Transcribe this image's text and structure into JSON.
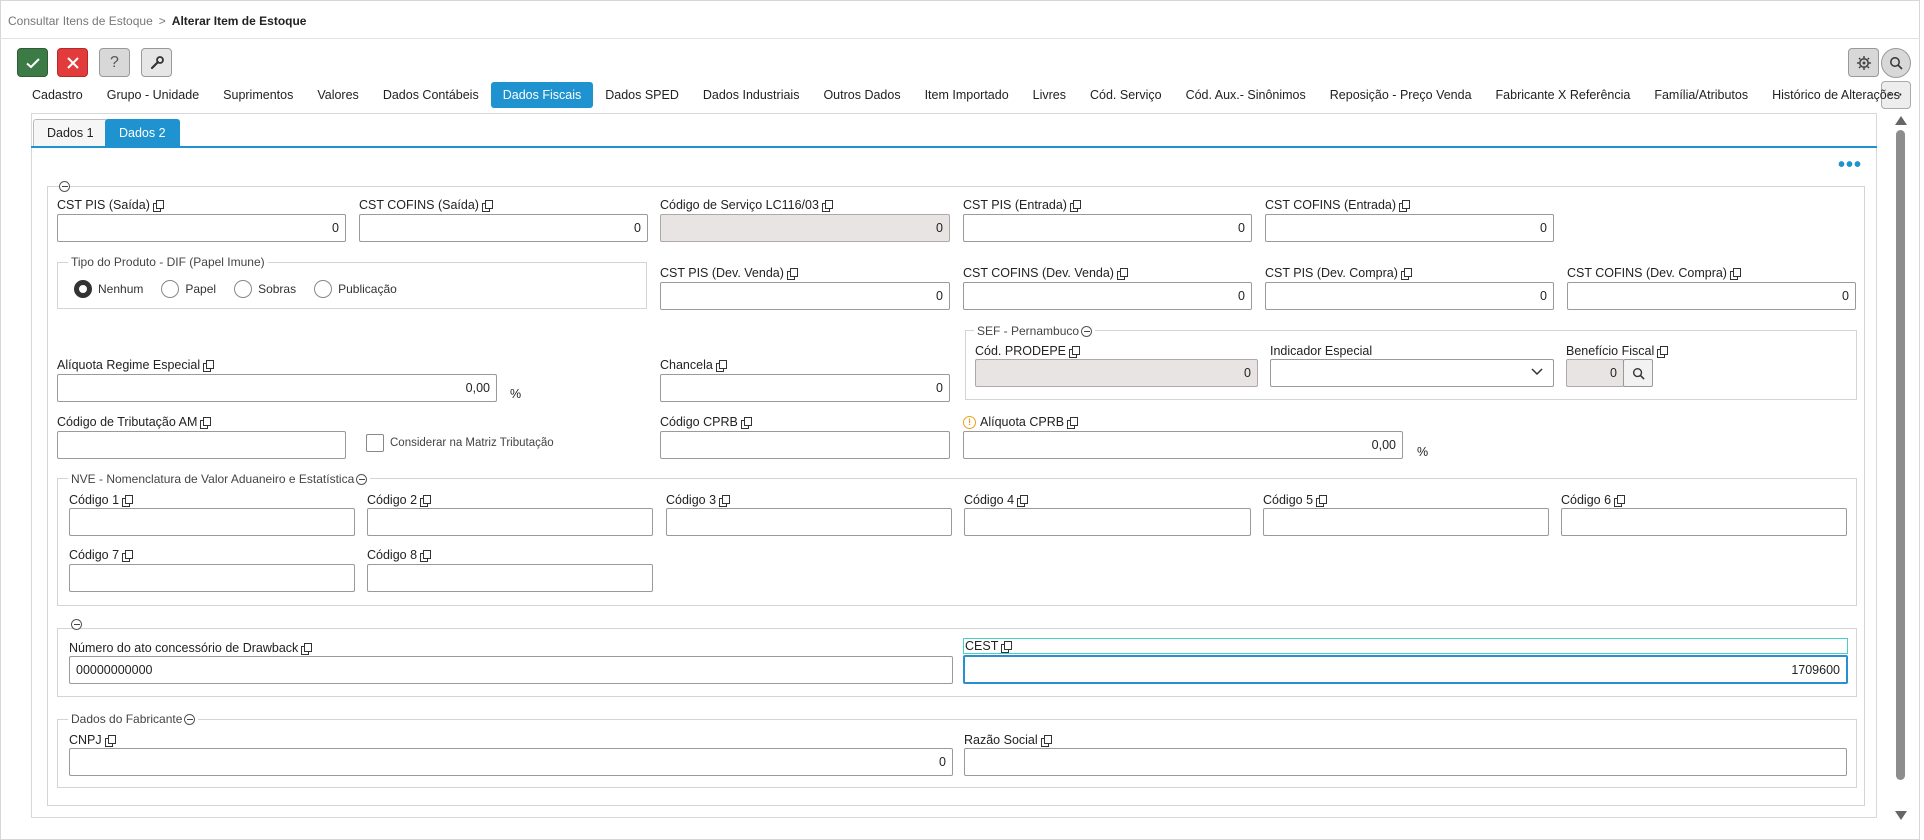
{
  "breadcrumb": {
    "parent": "Consultar Itens de Estoque",
    "separator": ">",
    "current": "Alterar Item de Estoque"
  },
  "toolbar": {
    "help_label": "?",
    "more_label": "···"
  },
  "tabs": [
    {
      "label": "Cadastro"
    },
    {
      "label": "Grupo - Unidade"
    },
    {
      "label": "Suprimentos"
    },
    {
      "label": "Valores"
    },
    {
      "label": "Dados Contábeis"
    },
    {
      "label": "Dados Fiscais"
    },
    {
      "label": "Dados SPED"
    },
    {
      "label": "Dados Industriais"
    },
    {
      "label": "Outros Dados"
    },
    {
      "label": "Item Importado"
    },
    {
      "label": "Livres"
    },
    {
      "label": "Cód. Serviço"
    },
    {
      "label": "Cód. Aux.- Sinônimos"
    },
    {
      "label": "Reposição - Preço Venda"
    },
    {
      "label": "Fabricante X Referência"
    },
    {
      "label": "Família/Atributos"
    },
    {
      "label": "Histórico de Alterações"
    }
  ],
  "active_tab": "Dados Fiscais",
  "subtabs": [
    {
      "label": "Dados 1"
    },
    {
      "label": "Dados 2"
    }
  ],
  "active_subtab": "Dados 2",
  "fields": {
    "cst_pis_saida": {
      "label": "CST PIS (Saída)",
      "value": "0"
    },
    "cst_cofins_saida": {
      "label": "CST COFINS (Saída)",
      "value": "0"
    },
    "codigo_servico": {
      "label": "Código de Serviço LC116/03",
      "value": "0"
    },
    "cst_pis_entrada": {
      "label": "CST PIS (Entrada)",
      "value": "0"
    },
    "cst_cofins_entrada": {
      "label": "CST COFINS (Entrada)",
      "value": "0"
    },
    "cst_pis_dev_venda": {
      "label": "CST PIS (Dev. Venda)",
      "value": "0"
    },
    "cst_cofins_dev_venda": {
      "label": "CST COFINS (Dev. Venda)",
      "value": "0"
    },
    "cst_pis_dev_compra": {
      "label": "CST PIS (Dev. Compra)",
      "value": "0"
    },
    "cst_cofins_dev_compra": {
      "label": "CST COFINS (Dev. Compra)",
      "value": "0"
    },
    "aliquota_regime": {
      "label": "Alíquota Regime Especial",
      "value": "0,00",
      "unit": "%"
    },
    "chancela": {
      "label": "Chancela",
      "value": "0"
    },
    "cod_prodepe": {
      "label": "Cód. PRODEPE",
      "value": "0"
    },
    "indicador_especial": {
      "label": "Indicador Especial",
      "value": ""
    },
    "beneficio_fiscal": {
      "label": "Benefício Fiscal",
      "value": "0"
    },
    "codigo_tributacao_am": {
      "label": "Código de Tributação AM",
      "value": ""
    },
    "considerar_matriz": {
      "label": "Considerar na Matriz Tributação"
    },
    "codigo_cprb": {
      "label": "Código CPRB",
      "value": ""
    },
    "aliquota_cprb": {
      "label": "Alíquota CPRB",
      "value": "0,00",
      "unit": "%"
    },
    "nve_codigo1": {
      "label": "Código 1",
      "value": ""
    },
    "nve_codigo2": {
      "label": "Código 2",
      "value": ""
    },
    "nve_codigo3": {
      "label": "Código 3",
      "value": ""
    },
    "nve_codigo4": {
      "label": "Código 4",
      "value": ""
    },
    "nve_codigo5": {
      "label": "Código 5",
      "value": ""
    },
    "nve_codigo6": {
      "label": "Código 6",
      "value": ""
    },
    "nve_codigo7": {
      "label": "Código 7",
      "value": ""
    },
    "nve_codigo8": {
      "label": "Código 8",
      "value": ""
    },
    "drawback": {
      "label": "Número do ato concessório de Drawback",
      "value": "00000000000"
    },
    "cest": {
      "label": "CEST",
      "value": "1709600"
    },
    "cnpj": {
      "label": "CNPJ",
      "value": "0"
    },
    "razao_social": {
      "label": "Razão Social",
      "value": ""
    }
  },
  "tipo_produto": {
    "legend": "Tipo do Produto - DIF (Papel Imune)",
    "options": [
      "Nenhum",
      "Papel",
      "Sobras",
      "Publicação"
    ],
    "selected": "Nenhum"
  },
  "sections": {
    "sef": "SEF - Pernambuco",
    "nve": "NVE - Nomenclatura de Valor Aduaneiro e Estatística",
    "fabricante": "Dados do Fabricante"
  },
  "colors": {
    "accent": "#1e93cf",
    "ok": "#3c7a46",
    "cancel": "#e23b3b",
    "warning": "#e8a21e"
  }
}
